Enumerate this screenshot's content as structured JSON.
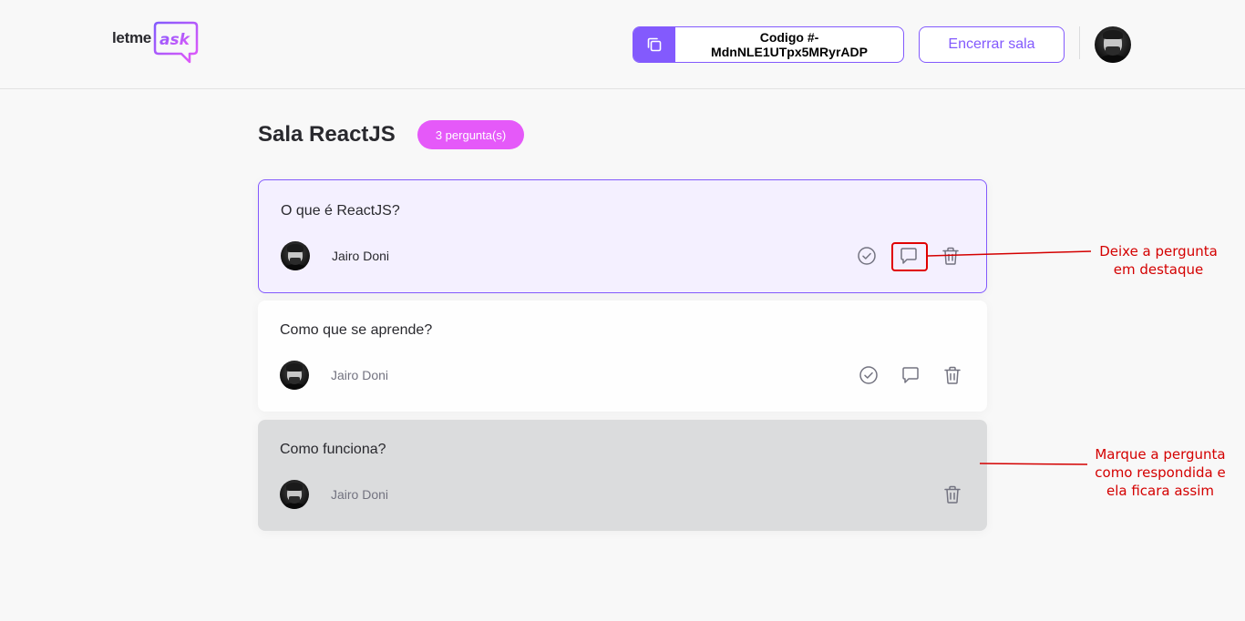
{
  "header": {
    "logo": {
      "text_letme": "letme",
      "text_ask": "ask"
    },
    "room_code": {
      "label": "Codigo #-MdnNLE1UTpx5MRyrADP",
      "icon": "copy-icon"
    },
    "end_room_label": "Encerrar sala",
    "avatar": "user-avatar"
  },
  "room": {
    "title": "Sala ReactJS",
    "count_label": "3 pergunta(s)"
  },
  "questions": [
    {
      "content": "O que é ReactJS?",
      "author": "Jairo Doni",
      "state": "highlighted"
    },
    {
      "content": "Como que se aprende?",
      "author": "Jairo Doni",
      "state": "normal"
    },
    {
      "content": "Como funciona?",
      "author": "Jairo Doni",
      "state": "answered"
    }
  ],
  "annotations": {
    "highlight_note_line1": "Deixe a pergunta",
    "highlight_note_line2": "em destaque",
    "answered_note_line1": "Marque a pergunta",
    "answered_note_line2": "como respondida e",
    "answered_note_line3": "ela ficara assim"
  },
  "colors": {
    "primary": "#835afd",
    "badge": "#e559f9",
    "highlight_bg": "#f4f0ff",
    "answered_bg": "#dbdcdd",
    "annotation": "#d40000"
  }
}
